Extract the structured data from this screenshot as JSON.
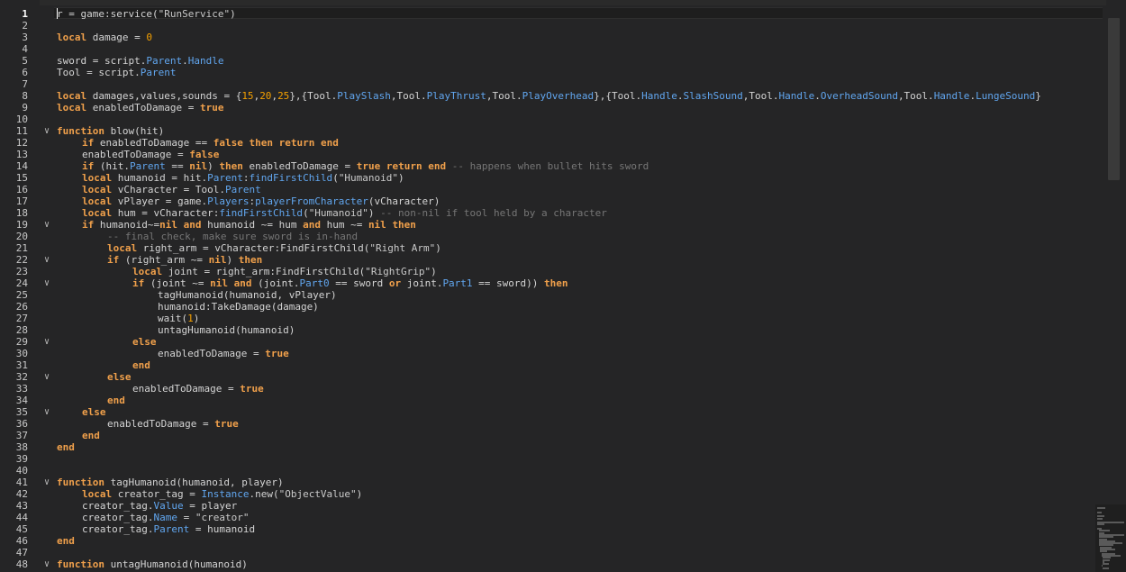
{
  "editor": {
    "current_line": 1,
    "lines": [
      {
        "n": 1,
        "fold": false,
        "indent": 0,
        "tokens": [
          [
            "txt",
            "r = game:service("
          ],
          [
            "str",
            "\"RunService\""
          ],
          [
            "txt",
            ")"
          ]
        ]
      },
      {
        "n": 2,
        "fold": false,
        "indent": 0,
        "tokens": []
      },
      {
        "n": 3,
        "fold": false,
        "indent": 0,
        "tokens": [
          [
            "kw",
            "local"
          ],
          [
            "txt",
            " damage = "
          ],
          [
            "num",
            "0"
          ]
        ]
      },
      {
        "n": 4,
        "fold": false,
        "indent": 0,
        "tokens": []
      },
      {
        "n": 5,
        "fold": false,
        "indent": 0,
        "tokens": [
          [
            "txt",
            "sword = script."
          ],
          [
            "prop",
            "Parent"
          ],
          [
            "txt",
            "."
          ],
          [
            "prop",
            "Handle"
          ]
        ]
      },
      {
        "n": 6,
        "fold": false,
        "indent": 0,
        "tokens": [
          [
            "txt",
            "Tool = script."
          ],
          [
            "prop",
            "Parent"
          ]
        ]
      },
      {
        "n": 7,
        "fold": false,
        "indent": 0,
        "tokens": []
      },
      {
        "n": 8,
        "fold": false,
        "indent": 0,
        "tokens": [
          [
            "kw",
            "local"
          ],
          [
            "txt",
            " damages,values,sounds = {"
          ],
          [
            "num",
            "15"
          ],
          [
            "txt",
            ","
          ],
          [
            "num",
            "20"
          ],
          [
            "txt",
            ","
          ],
          [
            "num",
            "25"
          ],
          [
            "txt",
            "},{Tool."
          ],
          [
            "prop",
            "PlaySlash"
          ],
          [
            "txt",
            ",Tool."
          ],
          [
            "prop",
            "PlayThrust"
          ],
          [
            "txt",
            ",Tool."
          ],
          [
            "prop",
            "PlayOverhead"
          ],
          [
            "txt",
            "},{Tool."
          ],
          [
            "prop",
            "Handle"
          ],
          [
            "txt",
            "."
          ],
          [
            "prop",
            "SlashSound"
          ],
          [
            "txt",
            ",Tool."
          ],
          [
            "prop",
            "Handle"
          ],
          [
            "txt",
            "."
          ],
          [
            "prop",
            "OverheadSound"
          ],
          [
            "txt",
            ",Tool."
          ],
          [
            "prop",
            "Handle"
          ],
          [
            "txt",
            "."
          ],
          [
            "prop",
            "LungeSound"
          ],
          [
            "txt",
            "}"
          ]
        ]
      },
      {
        "n": 9,
        "fold": false,
        "indent": 0,
        "tokens": [
          [
            "kw",
            "local"
          ],
          [
            "txt",
            " enabledToDamage = "
          ],
          [
            "kw",
            "true"
          ]
        ]
      },
      {
        "n": 10,
        "fold": false,
        "indent": 0,
        "tokens": []
      },
      {
        "n": 11,
        "fold": true,
        "indent": 0,
        "tokens": [
          [
            "kw",
            "function"
          ],
          [
            "txt",
            " blow(hit)"
          ]
        ]
      },
      {
        "n": 12,
        "fold": false,
        "indent": 1,
        "tokens": [
          [
            "kw",
            "if"
          ],
          [
            "txt",
            " enabledToDamage == "
          ],
          [
            "kw",
            "false"
          ],
          [
            "txt",
            " "
          ],
          [
            "kw",
            "then"
          ],
          [
            "txt",
            " "
          ],
          [
            "kw",
            "return"
          ],
          [
            "txt",
            " "
          ],
          [
            "kw",
            "end"
          ]
        ]
      },
      {
        "n": 13,
        "fold": false,
        "indent": 1,
        "tokens": [
          [
            "txt",
            "enabledToDamage = "
          ],
          [
            "kw",
            "false"
          ]
        ]
      },
      {
        "n": 14,
        "fold": false,
        "indent": 1,
        "tokens": [
          [
            "kw",
            "if"
          ],
          [
            "txt",
            " (hit."
          ],
          [
            "prop",
            "Parent"
          ],
          [
            "txt",
            " == "
          ],
          [
            "kw",
            "nil"
          ],
          [
            "txt",
            ") "
          ],
          [
            "kw",
            "then"
          ],
          [
            "txt",
            " enabledToDamage = "
          ],
          [
            "kw",
            "true"
          ],
          [
            "txt",
            " "
          ],
          [
            "kw",
            "return"
          ],
          [
            "txt",
            " "
          ],
          [
            "kw",
            "end"
          ],
          [
            "txt",
            " "
          ],
          [
            "com",
            "-- happens when bullet hits sword"
          ]
        ]
      },
      {
        "n": 15,
        "fold": false,
        "indent": 1,
        "tokens": [
          [
            "kw",
            "local"
          ],
          [
            "txt",
            " humanoid = hit."
          ],
          [
            "prop",
            "Parent"
          ],
          [
            "txt",
            ":"
          ],
          [
            "prop",
            "findFirstChild"
          ],
          [
            "txt",
            "("
          ],
          [
            "str",
            "\"Humanoid\""
          ],
          [
            "txt",
            ")"
          ]
        ]
      },
      {
        "n": 16,
        "fold": false,
        "indent": 1,
        "tokens": [
          [
            "kw",
            "local"
          ],
          [
            "txt",
            " vCharacter = Tool."
          ],
          [
            "prop",
            "Parent"
          ]
        ]
      },
      {
        "n": 17,
        "fold": false,
        "indent": 1,
        "tokens": [
          [
            "kw",
            "local"
          ],
          [
            "txt",
            " vPlayer = game."
          ],
          [
            "prop",
            "Players"
          ],
          [
            "txt",
            ":"
          ],
          [
            "prop",
            "playerFromCharacter"
          ],
          [
            "txt",
            "(vCharacter)"
          ]
        ]
      },
      {
        "n": 18,
        "fold": false,
        "indent": 1,
        "tokens": [
          [
            "kw",
            "local"
          ],
          [
            "txt",
            " hum = vCharacter:"
          ],
          [
            "prop",
            "findFirstChild"
          ],
          [
            "txt",
            "("
          ],
          [
            "str",
            "\"Humanoid\""
          ],
          [
            "txt",
            ") "
          ],
          [
            "com",
            "-- non-nil if tool held by a character"
          ]
        ]
      },
      {
        "n": 19,
        "fold": true,
        "indent": 1,
        "tokens": [
          [
            "kw",
            "if"
          ],
          [
            "txt",
            " humanoid~="
          ],
          [
            "kw",
            "nil"
          ],
          [
            "txt",
            " "
          ],
          [
            "kw",
            "and"
          ],
          [
            "txt",
            " humanoid ~= hum "
          ],
          [
            "kw",
            "and"
          ],
          [
            "txt",
            " hum ~= "
          ],
          [
            "kw",
            "nil"
          ],
          [
            "txt",
            " "
          ],
          [
            "kw",
            "then"
          ]
        ]
      },
      {
        "n": 20,
        "fold": false,
        "indent": 2,
        "tokens": [
          [
            "com",
            "-- final check, make sure sword is in-hand"
          ]
        ]
      },
      {
        "n": 21,
        "fold": false,
        "indent": 2,
        "tokens": [
          [
            "kw",
            "local"
          ],
          [
            "txt",
            " right_arm = vCharacter:FindFirstChild("
          ],
          [
            "str",
            "\"Right Arm\""
          ],
          [
            "txt",
            ")"
          ]
        ]
      },
      {
        "n": 22,
        "fold": true,
        "indent": 2,
        "tokens": [
          [
            "kw",
            "if"
          ],
          [
            "txt",
            " (right_arm ~= "
          ],
          [
            "kw",
            "nil"
          ],
          [
            "txt",
            ") "
          ],
          [
            "kw",
            "then"
          ]
        ]
      },
      {
        "n": 23,
        "fold": false,
        "indent": 3,
        "tokens": [
          [
            "kw",
            "local"
          ],
          [
            "txt",
            " joint = right_arm:FindFirstChild("
          ],
          [
            "str",
            "\"RightGrip\""
          ],
          [
            "txt",
            ")"
          ]
        ]
      },
      {
        "n": 24,
        "fold": true,
        "indent": 3,
        "tokens": [
          [
            "kw",
            "if"
          ],
          [
            "txt",
            " (joint ~= "
          ],
          [
            "kw",
            "nil"
          ],
          [
            "txt",
            " "
          ],
          [
            "kw",
            "and"
          ],
          [
            "txt",
            " (joint."
          ],
          [
            "prop",
            "Part0"
          ],
          [
            "txt",
            " == sword "
          ],
          [
            "kw",
            "or"
          ],
          [
            "txt",
            " joint."
          ],
          [
            "prop",
            "Part1"
          ],
          [
            "txt",
            " == sword)) "
          ],
          [
            "kw",
            "then"
          ]
        ]
      },
      {
        "n": 25,
        "fold": false,
        "indent": 4,
        "tokens": [
          [
            "txt",
            "tagHumanoid(humanoid, vPlayer)"
          ]
        ]
      },
      {
        "n": 26,
        "fold": false,
        "indent": 4,
        "tokens": [
          [
            "txt",
            "humanoid:TakeDamage(damage)"
          ]
        ]
      },
      {
        "n": 27,
        "fold": false,
        "indent": 4,
        "tokens": [
          [
            "txt",
            "wait("
          ],
          [
            "num",
            "1"
          ],
          [
            "txt",
            ")"
          ]
        ]
      },
      {
        "n": 28,
        "fold": false,
        "indent": 4,
        "tokens": [
          [
            "txt",
            "untagHumanoid(humanoid)"
          ]
        ]
      },
      {
        "n": 29,
        "fold": true,
        "indent": 3,
        "tokens": [
          [
            "kw",
            "else"
          ]
        ]
      },
      {
        "n": 30,
        "fold": false,
        "indent": 4,
        "tokens": [
          [
            "txt",
            "enabledToDamage = "
          ],
          [
            "kw",
            "true"
          ]
        ]
      },
      {
        "n": 31,
        "fold": false,
        "indent": 3,
        "tokens": [
          [
            "kw",
            "end"
          ]
        ]
      },
      {
        "n": 32,
        "fold": true,
        "indent": 2,
        "tokens": [
          [
            "kw",
            "else"
          ]
        ]
      },
      {
        "n": 33,
        "fold": false,
        "indent": 3,
        "tokens": [
          [
            "txt",
            "enabledToDamage = "
          ],
          [
            "kw",
            "true"
          ]
        ]
      },
      {
        "n": 34,
        "fold": false,
        "indent": 2,
        "tokens": [
          [
            "kw",
            "end"
          ]
        ]
      },
      {
        "n": 35,
        "fold": true,
        "indent": 1,
        "tokens": [
          [
            "kw",
            "else"
          ]
        ]
      },
      {
        "n": 36,
        "fold": false,
        "indent": 2,
        "tokens": [
          [
            "txt",
            "enabledToDamage = "
          ],
          [
            "kw",
            "true"
          ]
        ]
      },
      {
        "n": 37,
        "fold": false,
        "indent": 1,
        "tokens": [
          [
            "kw",
            "end"
          ]
        ]
      },
      {
        "n": 38,
        "fold": false,
        "indent": 0,
        "tokens": [
          [
            "kw",
            "end"
          ]
        ]
      },
      {
        "n": 39,
        "fold": false,
        "indent": 0,
        "tokens": []
      },
      {
        "n": 40,
        "fold": false,
        "indent": 0,
        "tokens": []
      },
      {
        "n": 41,
        "fold": true,
        "indent": 0,
        "tokens": [
          [
            "kw",
            "function"
          ],
          [
            "txt",
            " tagHumanoid(humanoid, player)"
          ]
        ]
      },
      {
        "n": 42,
        "fold": false,
        "indent": 1,
        "tokens": [
          [
            "kw",
            "local"
          ],
          [
            "txt",
            " creator_tag = "
          ],
          [
            "prop",
            "Instance"
          ],
          [
            "txt",
            ".new("
          ],
          [
            "str",
            "\"ObjectValue\""
          ],
          [
            "txt",
            ")"
          ]
        ]
      },
      {
        "n": 43,
        "fold": false,
        "indent": 1,
        "tokens": [
          [
            "txt",
            "creator_tag."
          ],
          [
            "prop",
            "Value"
          ],
          [
            "txt",
            " = player"
          ]
        ]
      },
      {
        "n": 44,
        "fold": false,
        "indent": 1,
        "tokens": [
          [
            "txt",
            "creator_tag."
          ],
          [
            "prop",
            "Name"
          ],
          [
            "txt",
            " = "
          ],
          [
            "str",
            "\"creator\""
          ]
        ]
      },
      {
        "n": 45,
        "fold": false,
        "indent": 1,
        "tokens": [
          [
            "txt",
            "creator_tag."
          ],
          [
            "prop",
            "Parent"
          ],
          [
            "txt",
            " = humanoid"
          ]
        ]
      },
      {
        "n": 46,
        "fold": false,
        "indent": 0,
        "tokens": [
          [
            "kw",
            "end"
          ]
        ]
      },
      {
        "n": 47,
        "fold": false,
        "indent": 0,
        "tokens": []
      },
      {
        "n": 48,
        "fold": true,
        "indent": 0,
        "tokens": [
          [
            "kw",
            "function"
          ],
          [
            "txt",
            " untagHumanoid(humanoid)"
          ]
        ]
      }
    ]
  },
  "icons": {
    "fold": "chevron-down-icon"
  },
  "colors": {
    "background": "#252526",
    "keyword": "#f0a04b",
    "property": "#61a6ef",
    "number": "#f4a000",
    "comment": "#767676",
    "text": "#d4d4d4"
  }
}
